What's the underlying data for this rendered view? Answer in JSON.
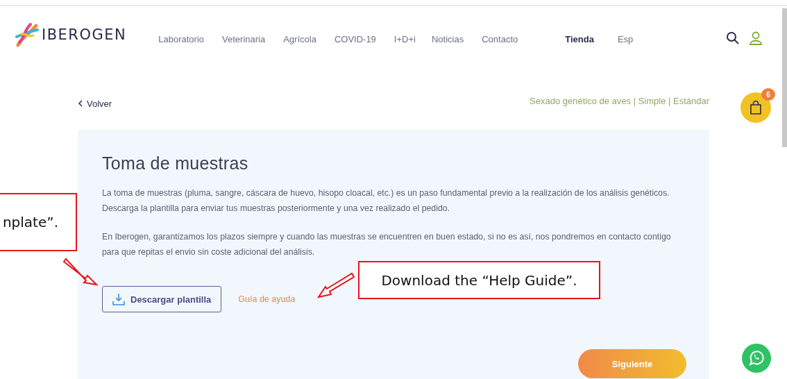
{
  "header": {
    "logo": "IBEROGEN",
    "nav": [
      {
        "label": "Laboratorio",
        "selected": false
      },
      {
        "label": "Veterinaria",
        "selected": false
      },
      {
        "label": "Agrícola",
        "selected": false
      },
      {
        "label": "COVID-19",
        "selected": false
      },
      {
        "label": "I+D+i",
        "selected": false
      },
      {
        "label": "Noticias",
        "selected": false
      },
      {
        "label": "Contacto",
        "selected": false
      },
      {
        "label": "Tienda",
        "selected": true
      },
      {
        "label": "Esp",
        "selected": false
      }
    ]
  },
  "back_link": "Volver",
  "product": "Sexado genético de aves | Simple | Estándar",
  "cart": {
    "count": "6"
  },
  "card": {
    "title": "Toma de muestras",
    "paragraphs": [
      "La toma de muestras (pluma, sangre, cáscara de huevo, hisopo cloacal, etc.) es un paso fundamental previo a la realización de los análisis genéticos. Descarga la plantilla para enviar tus muestras posteriormente y una vez realizado el pedido.",
      "En Iberogen, garantizamos los plazos siempre y cuando las muestras se encuentren en buen estado, si no es así, nos pondremos en contacto contigo para que repitas el envio sin coste adicional del análisis."
    ],
    "download_button": "Descargar plantilla",
    "help_link": "Guía de ayuda",
    "next_button": "Siguiente"
  },
  "annotations": [
    {
      "text": "nplate”."
    },
    {
      "text": "Download the “Help Guide”."
    }
  ]
}
